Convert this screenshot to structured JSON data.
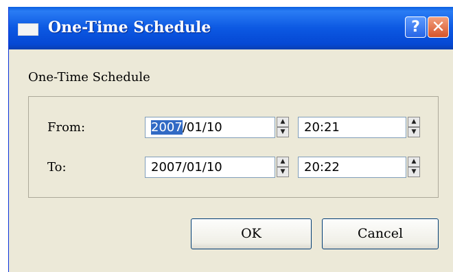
{
  "window": {
    "title": "One-Time Schedule",
    "help_glyph": "?",
    "close_glyph": "✕"
  },
  "section_label": "One-Time Schedule",
  "from": {
    "label": "From:",
    "date_year": "2007",
    "date_rest": "/01/10",
    "time": "20:21"
  },
  "to": {
    "label": "To:",
    "date": "2007/01/10",
    "time": "20:22"
  },
  "buttons": {
    "ok": "OK",
    "cancel": "Cancel"
  },
  "icons": {
    "app": "window-icon",
    "help": "help-icon",
    "close": "close-icon",
    "spin": "spin-updown-icon"
  },
  "colors": {
    "titlebar": "#0c58e2",
    "dialog_bg": "#ece9d8",
    "selection": "#316ac5",
    "close_button": "#d6542a"
  }
}
